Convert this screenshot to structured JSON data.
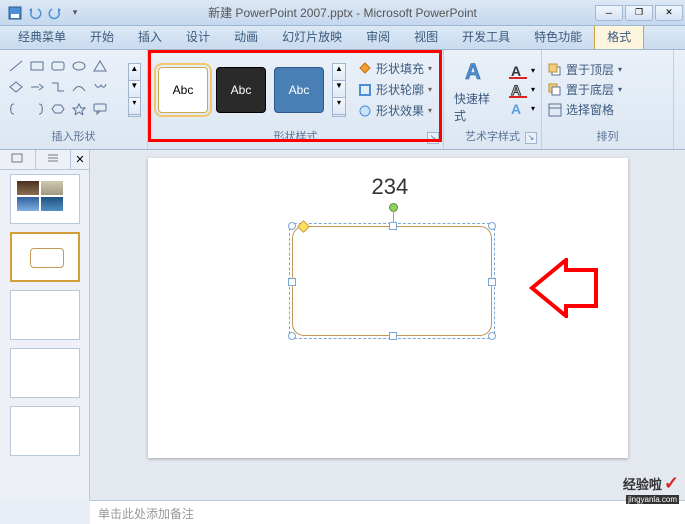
{
  "window": {
    "title": "新建 PowerPoint 2007.pptx - Microsoft PowerPoint"
  },
  "tabs": {
    "classic": "经典菜单",
    "home": "开始",
    "insert": "插入",
    "design": "设计",
    "anim": "动画",
    "slideshow": "幻灯片放映",
    "review": "审阅",
    "view": "视图",
    "dev": "开发工具",
    "addin": "特色功能",
    "format": "格式"
  },
  "ribbon": {
    "insertShapes": "插入形状",
    "shapeStyles": "形状样式",
    "wordArtStyles": "艺术字样式",
    "arrange": "排列",
    "abc": "Abc",
    "shapeFill": "形状填充",
    "shapeOutline": "形状轮廓",
    "shapeEffects": "形状效果",
    "quickStyles": "快速样式",
    "bringFront": "置于顶层",
    "sendBack": "置于底层",
    "selectionPane": "选择窗格"
  },
  "slidepanel": {
    "tab1": "",
    "tab2": ""
  },
  "slide": {
    "text1": "234"
  },
  "notes": "单击此处添加备注",
  "watermark": {
    "brand": "经验啦",
    "url": "jingyanla.com"
  }
}
